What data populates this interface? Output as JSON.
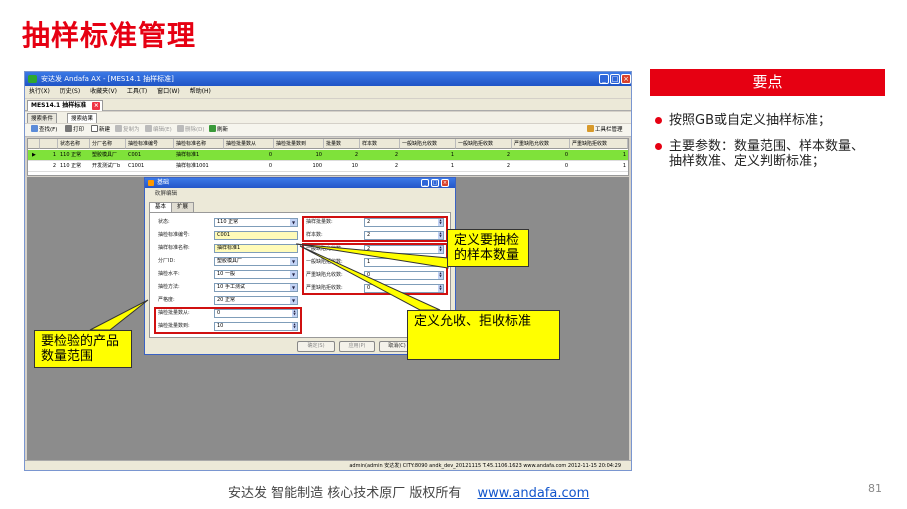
{
  "slide": {
    "title": "抽样标准管理",
    "page_number": "81",
    "footer_text": "安达发   智能制造 核心技术原厂   版权所有",
    "footer_link": "www.andafa.com"
  },
  "key_points": {
    "header": "要点",
    "items": [
      "按照GB或自定义抽样标准；",
      "主要参数：数量范围、样本数量、抽样数准、定义判断标准；"
    ]
  },
  "app": {
    "title": "安达发 Andafa AX - [MES14.1 抽样标准]",
    "menu": [
      "执行(X)",
      "历史(S)",
      "收藏夹(V)",
      "工具(T)",
      "窗口(W)",
      "帮助(H)"
    ],
    "doc_tab": "MES14.1 抽样标准",
    "sub_tabs": [
      "搜索条件",
      "搜索结果"
    ],
    "toolbar": {
      "find": "查找(F)",
      "print": "打印",
      "new": "新建",
      "copy": "复制为",
      "edit": "编辑(E)",
      "delete": "删除(D)",
      "refresh": "刷新",
      "toolbar_mgmt": "工具栏管理"
    },
    "grid": {
      "columns": [
        "状态名称",
        "分厂名称",
        "抽检标准编号",
        "抽检标准名称",
        "抽检批量数从",
        "抽检批量数到",
        "批量数",
        "样本数",
        "一般缺陷允收数",
        "一般缺陷拒收数",
        "严重缺陷允收数",
        "严重缺陷拒收数"
      ],
      "rows": [
        [
          "1",
          "110 正常",
          "塑胶模具厂",
          "C001",
          "抽样标准1",
          "0",
          "10",
          "2",
          "2",
          "1",
          "2",
          "0",
          "1"
        ],
        [
          "2",
          "110 正常",
          "开发测试厂b",
          "C1001",
          "抽样标准1001",
          "0",
          "100",
          "10",
          "2",
          "1",
          "2",
          "0",
          "1"
        ]
      ]
    },
    "status_bar": "admin(admin 安达发)   CITY:8090   andk_dev_20121115   T.45.1106.1623   www.andafa.com   2012-11-15 20:04:29"
  },
  "dialog": {
    "title": "基础",
    "mode": "砍屏编辑",
    "tabs": [
      "基本",
      "扩展"
    ],
    "left_fields": [
      {
        "label": "状态:",
        "value": "110 正常"
      },
      {
        "label": "抽检标准编号:",
        "value": "C001"
      },
      {
        "label": "抽样标准名称:",
        "value": "抽样标准1"
      },
      {
        "label": "分厂ID:",
        "value": "塑胶模具厂"
      },
      {
        "label": "抽检水平:",
        "value": "10 一般"
      },
      {
        "label": "抽检方法:",
        "value": "10 手工测试"
      },
      {
        "label": "严格度:",
        "value": "20 正常"
      },
      {
        "label": "抽检批量数从:",
        "value": "0"
      },
      {
        "label": "抽检批量数到:",
        "value": "10"
      }
    ],
    "right_fields": [
      {
        "label": "抽样批量数:",
        "value": "2"
      },
      {
        "label": "样本数:",
        "value": "2"
      },
      {
        "label": "一般缺陷允收数:",
        "value": "2"
      },
      {
        "label": "一般缺陷拒收数:",
        "value": "1"
      },
      {
        "label": "严重缺陷允收数:",
        "value": "0"
      },
      {
        "label": "严重缺陷拒收数:",
        "value": "0"
      }
    ],
    "buttons": [
      "确定(S)",
      "应用(P)",
      "取消(C)"
    ]
  },
  "callouts": {
    "sample_count": "定义要抽检的样本数量",
    "accept_reject": "定义允收、拒收标准",
    "quantity_range": "要检验的产品数量范围"
  },
  "colors": {
    "brand_red": "#e60012",
    "callout_yellow": "#ffff00",
    "selected_row": "#7fe23a"
  }
}
